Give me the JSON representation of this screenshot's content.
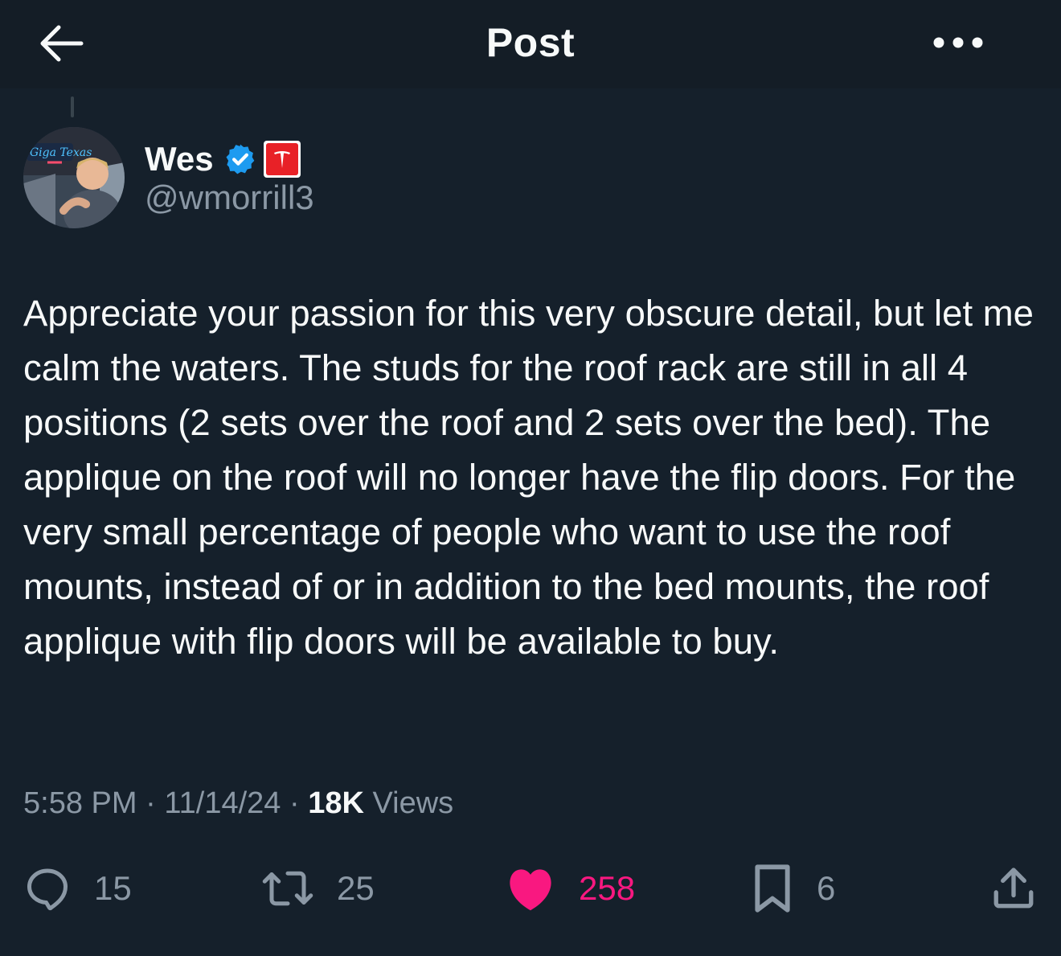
{
  "header": {
    "title": "Post",
    "back_icon": "arrow-left-icon",
    "more_icon": "more-horizontal-icon"
  },
  "author": {
    "display_name": "Wes",
    "handle": "@wmorrill3",
    "verified_badge": "verified-badge-icon",
    "affiliate_badge": "tesla-affiliate-icon",
    "avatar_sign_text": "Giga Texas"
  },
  "tweet": {
    "text": "Appreciate your passion for this very obscure detail, but let me calm the waters. The studs for the roof rack are still in all 4 positions (2 sets over the roof and 2 sets over the bed). The applique on the roof will no longer have the flip doors. For the very small percentage of people who want to use the roof mounts, instead of or in addition to the bed mounts, the roof applique with flip doors will be available to buy."
  },
  "meta": {
    "time": "5:58 PM",
    "separator": "·",
    "date": "11/14/24",
    "views_count": "18K",
    "views_label": "Views"
  },
  "actions": {
    "replies": "15",
    "reposts": "25",
    "likes": "258",
    "bookmarks": "6"
  },
  "colors": {
    "background": "#15202b",
    "text_primary": "#f7f9f9",
    "text_secondary": "#8b98a5",
    "like_active": "#f91880",
    "verified_blue": "#1d9bf0",
    "tesla_red": "#e82127"
  }
}
